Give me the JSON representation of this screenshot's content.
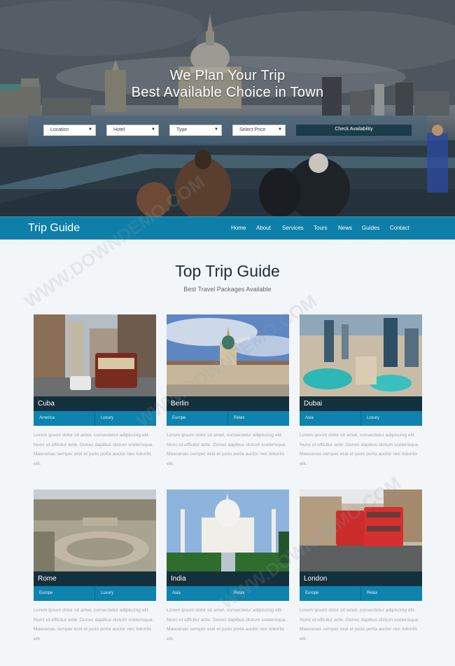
{
  "hero": {
    "title_line1": "We Plan Your Trip",
    "title_line2": "Best Available Choice in Town"
  },
  "search": {
    "location": "Location",
    "hotel": "Hotel",
    "type": "Type",
    "price": "Select Price",
    "button": "Check Availability"
  },
  "nav": {
    "brand": "Trip Guide",
    "items": [
      "Home",
      "About",
      "Services",
      "Tours",
      "News",
      "Guides",
      "Contact"
    ]
  },
  "section": {
    "title": "Top Trip Guide",
    "subtitle": "Best Travel Packages Available"
  },
  "cards": [
    {
      "name": "Cuba",
      "tag1": "America",
      "tag2": "Luxury",
      "desc": "Lorem ipsum dolor sit amet, consectetur adipiscing elit. Nunc ut efficitur ante. Donec dapibus dictum scelerisque. Maecenas semper erat et justo porta auctor nec lobortis elit."
    },
    {
      "name": "Berlin",
      "tag1": "Europe",
      "tag2": "Relax",
      "desc": "Lorem ipsum dolor sit amet, consectetur adipiscing elit. Nunc ut efficitur ante. Donec dapibus dictum scelerisque. Maecenas semper erat et justo porta auctor nec lobortis elit."
    },
    {
      "name": "Dubai",
      "tag1": "Asia",
      "tag2": "Luxury",
      "desc": "Lorem ipsum dolor sit amet, consectetur adipiscing elit. Nunc ut efficitur ante. Donec dapibus dictum scelerisque. Maecenas semper erat et justo porta auctor nec lobortis elit."
    },
    {
      "name": "Rome",
      "tag1": "Europe",
      "tag2": "Luxury",
      "desc": "Lorem ipsum dolor sit amet, consectetur adipiscing elit. Nunc ut efficitur ante. Donec dapibus dictum scelerisque. Maecenas semper erat et justo porta auctor nec lobortis elit."
    },
    {
      "name": "India",
      "tag1": "Asia",
      "tag2": "Relax",
      "desc": "Lorem ipsum dolor sit amet, consectetur adipiscing elit. Nunc ut efficitur ante. Donec dapibus dictum scelerisque. Maecenas semper erat et justo porta auctor nec lobortis elit."
    },
    {
      "name": "London",
      "tag1": "Europe",
      "tag2": "Relax",
      "desc": "Lorem ipsum dolor sit amet, consectetur adipiscing elit. Nunc ut efficitur ante. Donec dapibus dictum scelerisque. Maecenas semper erat et justo porta auctor nec lobortis elit."
    }
  ],
  "watermark": "WWW.DOWNDEMO.COM",
  "colors": {
    "nav": "#0e7fa8",
    "name_bar": "#14303c",
    "tag_bar": "#0e83ae",
    "button": "#1b3c4b"
  }
}
